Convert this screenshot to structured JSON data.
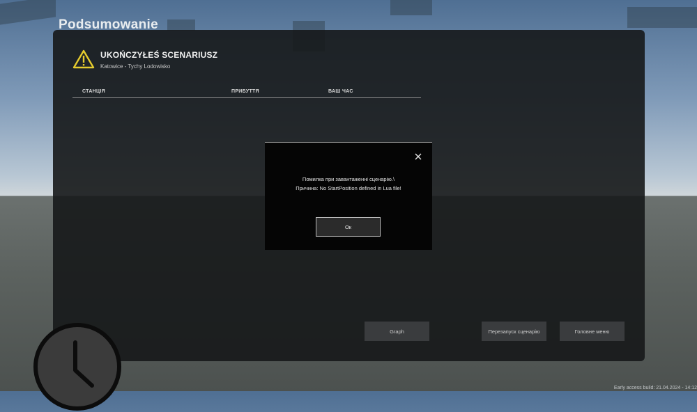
{
  "page": {
    "title": "Podsumowanie",
    "build_info": "Early access build: 21.04.2024 - 14:12"
  },
  "summary": {
    "title": "UKOŃCZYŁEŚ SCENARIUSZ",
    "subtitle": "Katowice - Tychy Lodowisko",
    "icon": "warning-triangle-icon",
    "icon_color": "#e6cc2e"
  },
  "table": {
    "columns": [
      "СТАНЦІЯ",
      "ПРИБУТТЯ",
      "ВАШ ЧАС"
    ],
    "rows": []
  },
  "dialog": {
    "message_line1": "Помилка при завантаженні сценарію.\\",
    "message_line2": "Причина: No StartPosition defined in Lua file!",
    "ok_label": "Ок",
    "close_icon": "close-icon"
  },
  "buttons": {
    "graph": "Graph",
    "restart": "Перезапуск сценарію",
    "main_menu": "Головне меню"
  },
  "colors": {
    "panel_bg": "#16181a",
    "button_bg": "#3a3c3e",
    "dialog_bg": "#050505"
  }
}
